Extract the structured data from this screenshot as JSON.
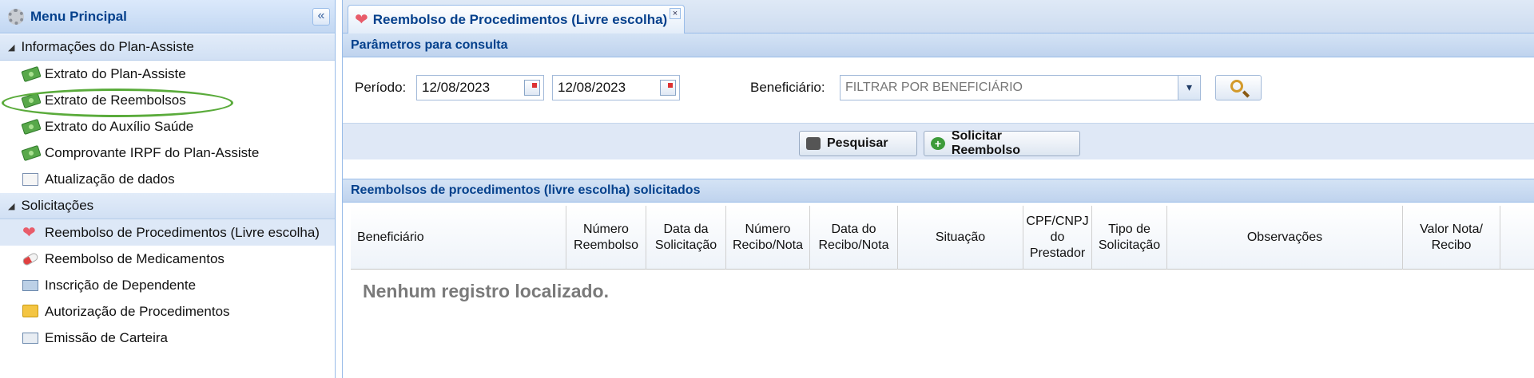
{
  "sidebar": {
    "title": "Menu Principal",
    "collapse_label": "«",
    "sections": [
      {
        "label": "Informações do Plan-Assiste",
        "items": [
          {
            "label": "Extrato do Plan-Assiste",
            "icon": "money-icon"
          },
          {
            "label": "Extrato de Reembolsos",
            "icon": "money-icon"
          },
          {
            "label": "Extrato do Auxílio Saúde",
            "icon": "money-icon"
          },
          {
            "label": "Comprovante IRPF do Plan-Assiste",
            "icon": "money-icon"
          },
          {
            "label": "Atualização de dados",
            "icon": "form-icon"
          }
        ]
      },
      {
        "label": "Solicitações",
        "items": [
          {
            "label": "Reembolso de Procedimentos (Livre escolha)",
            "icon": "heart-icon",
            "active": true
          },
          {
            "label": "Reembolso de Medicamentos",
            "icon": "pill-icon"
          },
          {
            "label": "Inscrição de Dependente",
            "icon": "card-add-icon"
          },
          {
            "label": "Autorização de Procedimentos",
            "icon": "folder-icon"
          },
          {
            "label": "Emissão de Carteira",
            "icon": "id-card-icon"
          }
        ]
      }
    ]
  },
  "tab": {
    "title": "Reembolso de Procedimentos (Livre escolha)",
    "close_label": "×"
  },
  "params": {
    "header": "Parâmetros para consulta",
    "periodo_label": "Período:",
    "date_from": "12/08/2023",
    "date_to": "12/08/2023",
    "beneficiario_label": "Beneficiário:",
    "beneficiario_placeholder": "FILTRAR POR BENEFICIÁRIO",
    "dropdown_glyph": "▾"
  },
  "actions": {
    "pesquisar": "Pesquisar",
    "solicitar": "Solicitar Reembolso",
    "plus_glyph": "+"
  },
  "grid": {
    "header": "Reembolsos de procedimentos (livre escolha) solicitados",
    "columns": [
      "Beneficiário",
      "Número Reembolso",
      "Data da Solicitação",
      "Número Recibo/Nota",
      "Data do Recibo/Nota",
      "Situação",
      "CPF/CNPJ do Prestador",
      "Tipo de Solicitação",
      "Observações",
      "Valor Nota/ Recibo"
    ],
    "empty_message": "Nenhum registro localizado."
  },
  "colors": {
    "accent": "#04408c",
    "border": "#99bce8",
    "highlight": "#5aab3b"
  }
}
